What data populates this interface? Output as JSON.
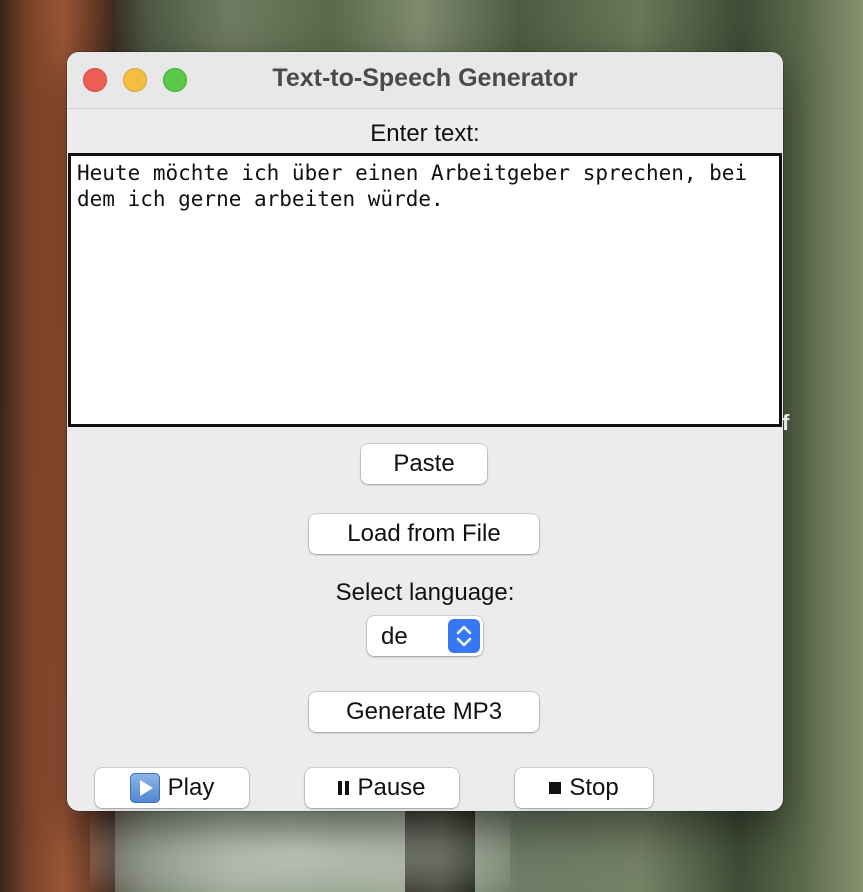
{
  "window": {
    "title": "Text-to-Speech Generator"
  },
  "text_section": {
    "label": "Enter text:",
    "content": "Heute möchte ich über einen Arbeitgeber sprechen, bei dem ich gerne arbeiten würde."
  },
  "buttons": {
    "paste": "Paste",
    "load": "Load from File",
    "generate": "Generate MP3",
    "play": "Play",
    "pause": "Pause",
    "stop": "Stop"
  },
  "language": {
    "label": "Select language:",
    "selected": "de"
  },
  "stray_text": "f",
  "icons": {
    "play": "play-icon",
    "pause": "pause-icon",
    "stop": "stop-icon",
    "select_arrows": "chevron-updown-icon"
  },
  "colors": {
    "close": "#ee5e55",
    "minimize": "#f5bd42",
    "zoom": "#5cc84a",
    "select_accent": "#3478f6"
  }
}
